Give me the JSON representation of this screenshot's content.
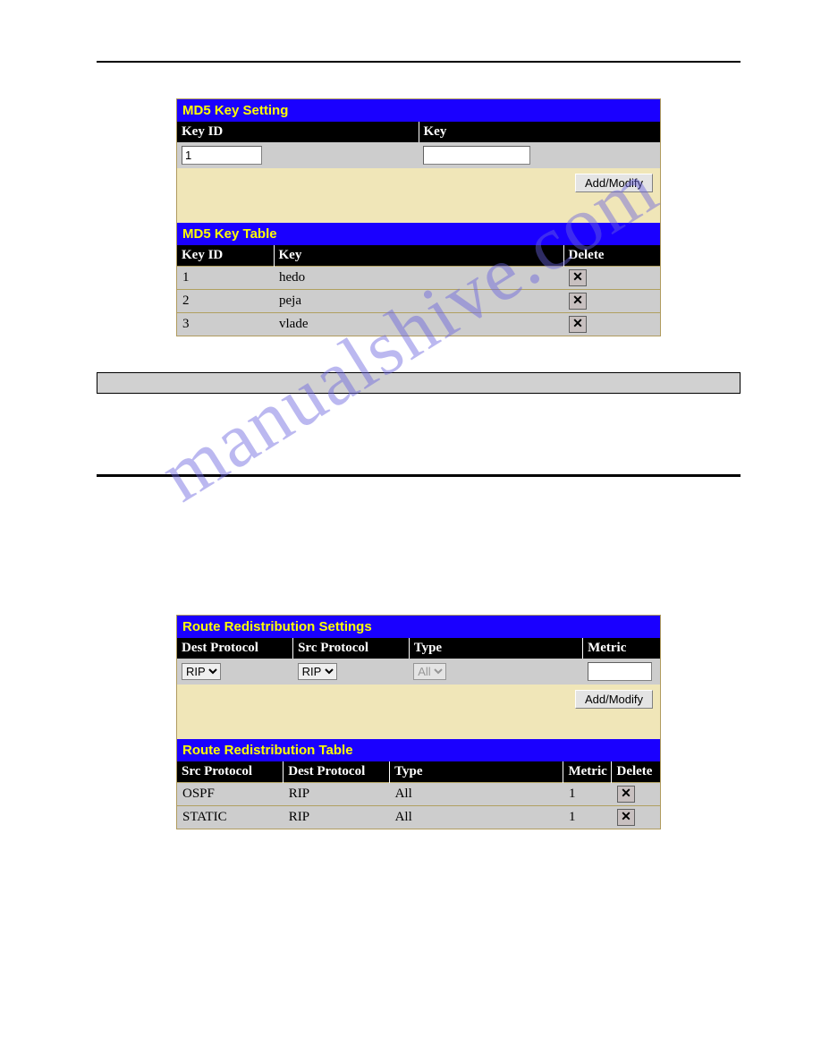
{
  "md5_setting": {
    "title": "MD5 Key Setting",
    "headers": {
      "key_id": "Key ID",
      "key": "Key"
    },
    "form": {
      "key_id_value": "1",
      "key_value": ""
    },
    "button": "Add/Modify"
  },
  "md5_table": {
    "title": "MD5 Key Table",
    "headers": {
      "key_id": "Key ID",
      "key": "Key",
      "delete": "Delete"
    },
    "rows": [
      {
        "id": "1",
        "key": "hedo"
      },
      {
        "id": "2",
        "key": "peja"
      },
      {
        "id": "3",
        "key": "vlade"
      }
    ]
  },
  "route_settings": {
    "title": "Route Redistribution Settings",
    "headers": {
      "dest": "Dest Protocol",
      "src": "Src Protocol",
      "type": "Type",
      "metric": "Metric"
    },
    "form": {
      "dest_value": "RIP",
      "src_value": "RIP",
      "type_value": "All",
      "metric_value": ""
    },
    "button": "Add/Modify"
  },
  "route_table": {
    "title": "Route Redistribution Table",
    "headers": {
      "src": "Src Protocol",
      "dest": "Dest Protocol",
      "type": "Type",
      "metric": "Metric",
      "delete": "Delete"
    },
    "rows": [
      {
        "src": "OSPF",
        "dest": "RIP",
        "type": "All",
        "metric": "1"
      },
      {
        "src": "STATIC",
        "dest": "RIP",
        "type": "All",
        "metric": "1"
      }
    ]
  },
  "watermark": "manualshive.com"
}
